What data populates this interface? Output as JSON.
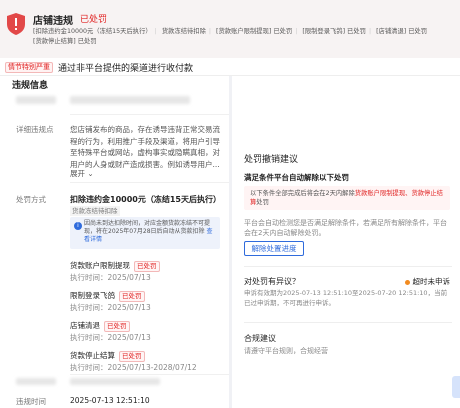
{
  "header": {
    "title": "店铺违规",
    "status": "已处罚",
    "tags_line1": [
      "[扣除违约金10000元（冻结15天后执行）",
      "货款冻结待扣除",
      "[货款账户限制提现] 已处罚",
      "[限制登录飞鸽] 已处罚",
      "[店铺清退] 已处罚"
    ],
    "tags_line2": [
      "[货款停止结算] 已处罚"
    ]
  },
  "alert": {
    "badge": "情节特别严重",
    "text": "通过非平台提供的渠道进行收付款"
  },
  "left": {
    "section_title": "违规信息",
    "detail_label": "详细违规点",
    "detail_text": "您店铺发布的商品，存在诱导违背正常交易流程的行为，利用推广手段及渠道，将用户引导至特殊平台或网站，虚构事实或隐瞒真相，对用户的人身或财产造成损害。例如诱导用户...",
    "expand_label": "展开",
    "penalty_label": "处罚方式",
    "penalty_title": "扣除违约金10000元（冻结15天后执行）",
    "penalty_sub": "货款冻结待扣除",
    "info_text": "因尚未到达扣除时间，对应金额货款冻结不可提现，将在2025年07月28日后自动从货款扣除",
    "info_link": "查看详情",
    "items": [
      {
        "name": "货款账户限制提现",
        "status": "已处罚",
        "time": "执行时间：2025/07/13"
      },
      {
        "name": "限制登录飞鸽",
        "status": "已处罚",
        "time": "执行时间：2025/07/13"
      },
      {
        "name": "店铺清退",
        "status": "已处罚",
        "time": "执行时间：2025/07/13"
      },
      {
        "name": "货款停止结算",
        "status": "已处罚",
        "time": "执行时间：2025/07/13-2028/07/12"
      }
    ],
    "violation_time_label": "违规时间",
    "violation_time": "2025-07-13 12:51:10"
  },
  "right": {
    "section_title": "处罚撤销建议",
    "cond_title": "满足条件平台自动解除以下处罚",
    "cond_text_a": "以下条件全部完成后将会在2天内解除",
    "cond_text_b": "货款账户限制提现、货款停止结算",
    "cond_text_c": "处罚",
    "desc": "平台会自动检测您是否满足解除条件，若满足所有解除条件，平台会在2天内自动解除处罚。",
    "button_label": "解除处置进度",
    "appeal_title": "对处罚有异议？",
    "appeal_status": "超时未申诉",
    "appeal_desc": "申诉有效期为2025-07-13 12:51:10至2025-07-20 12:51:10，当前已过申诉期，不可再进行申诉。",
    "sugg_title": "合规建议",
    "sugg_text": "请遵守平台规则，合规经营"
  },
  "colors": {
    "accent": "#2f6bdc",
    "danger": "#e02020",
    "warning": "#f28b20"
  }
}
